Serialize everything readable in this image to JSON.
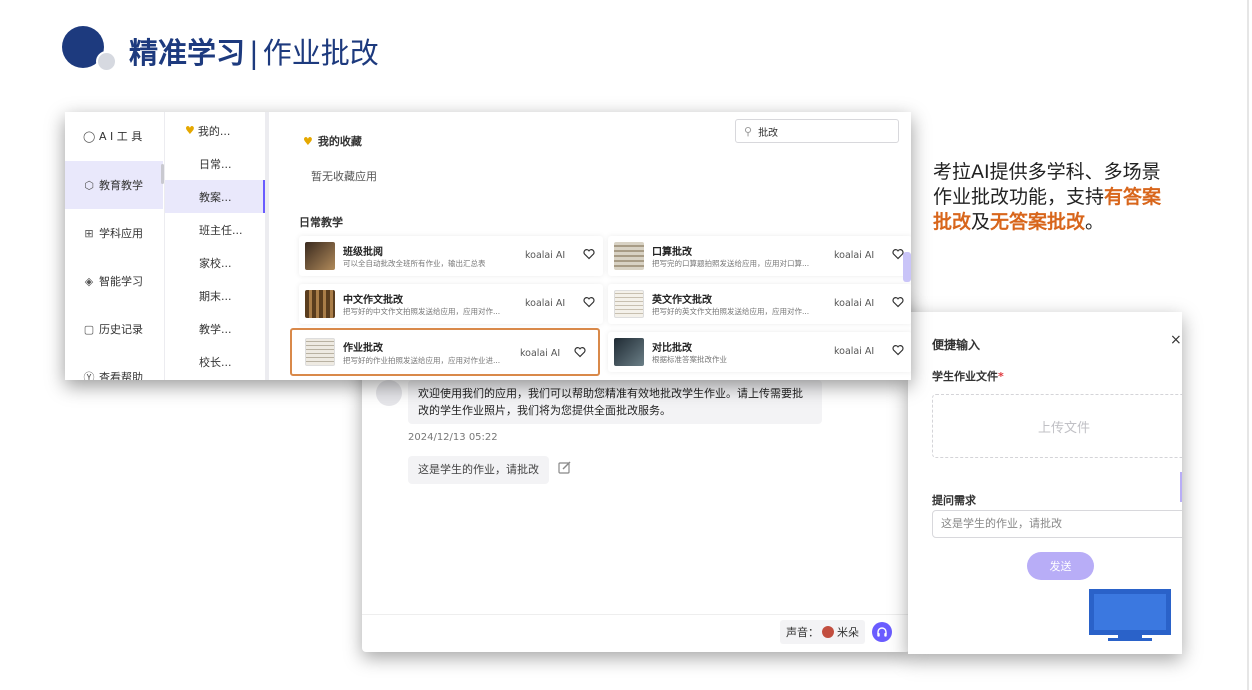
{
  "slide": {
    "title_bold": "精准学习",
    "title_sep": "|",
    "title_sub": "作业批改"
  },
  "caption": {
    "part1": "考拉AI提供多学科、多场景作业批改功能，支持",
    "hl1": "有答案批改",
    "part2": "及",
    "hl2": "无答案批改",
    "part3": "。"
  },
  "nav": {
    "items": [
      {
        "icon": "chat-bubble-icon",
        "label": "A I 工 具"
      },
      {
        "icon": "cube-icon",
        "label": "教育教学"
      },
      {
        "icon": "grid-icon",
        "label": "学科应用"
      },
      {
        "icon": "graduation-cap-icon",
        "label": "智能学习"
      },
      {
        "icon": "clipboard-icon",
        "label": "历史记录"
      },
      {
        "icon": "help-circle-icon",
        "label": "查看帮助"
      }
    ],
    "active_index": 1
  },
  "sub_nav": {
    "items": [
      "我的...",
      "日常...",
      "教案...",
      "班主任...",
      "家校...",
      "期末...",
      "教学...",
      "校长..."
    ],
    "active_index": 2
  },
  "content": {
    "search_value": "批改",
    "fav_title": "我的收藏",
    "fav_empty": "暂无收藏应用",
    "section_title": "日常教学",
    "cards": [
      {
        "name": "班级批阅",
        "desc": "可以全自动批改全班所有作业，输出汇总表",
        "vendor": "koalai AI"
      },
      {
        "name": "口算批改",
        "desc": "把写完的口算题拍照发送给应用，应用对口算...",
        "vendor": "koalai AI"
      },
      {
        "name": "中文作文批改",
        "desc": "把写好的中文作文拍照发送给应用，应用对作...",
        "vendor": "koalai AI"
      },
      {
        "name": "英文作文批改",
        "desc": "把写好的英文作文拍照发送给应用，应用对作...",
        "vendor": "koalai AI"
      },
      {
        "name": "作业批改",
        "desc": "把写好的作业拍照发送给应用，应用对作业进...",
        "vendor": "koalai AI"
      },
      {
        "name": "对比批改",
        "desc": "根据标准答案批改作业",
        "vendor": "koalai AI"
      }
    ]
  },
  "chat": {
    "bot_message": "欢迎使用我们的应用，我们可以帮助您精准有效地批改学生作业。请上传需要批改的学生作业照片，我们将为您提供全面批改服务。",
    "timestamp": "2024/12/13 05:22",
    "user_message": "这是学生的作业，请批改",
    "voice_label": "声音：",
    "voice_name": "米朵"
  },
  "quick_input": {
    "title": "便捷输入",
    "close": "×",
    "file_label": "学生作业文件",
    "required_mark": "*",
    "upload_text": "上传文件",
    "prompt_label": "提问需求",
    "prompt_value": "这是学生的作业，请批改",
    "send_label": "发送"
  },
  "colors": {
    "brand_navy": "#1d3a7e",
    "accent_purple": "#6a5cff",
    "highlight_orange": "#d8661c",
    "heart_gold": "#e5a800"
  }
}
